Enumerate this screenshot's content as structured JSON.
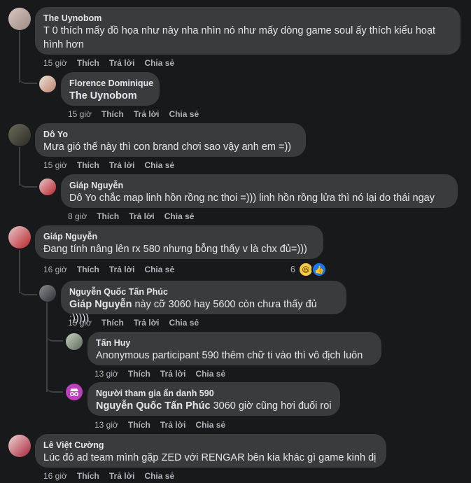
{
  "actions": {
    "like": "Thích",
    "reply": "Trả lời",
    "share": "Chia sẻ"
  },
  "comments": [
    {
      "author": "The Uynobom",
      "text": "T 0 thích mấy đồ họa như này nha nhìn nó như mấy dòng game soul ấy thích kiểu hoạt hình hơn",
      "time": "15 giờ"
    },
    {
      "author": "Florence Dominique",
      "mention": "The Uynobom",
      "text": "",
      "time": "15 giờ"
    },
    {
      "author": "Dô Yo",
      "text": "Mưa gió thế này thì con brand chơi sao vậy anh em =))",
      "time": "15 giờ"
    },
    {
      "author": "Giáp Nguyễn",
      "mention": "Dô Yo",
      "text": " chắc map linh hồn rồng nc thoi =))) linh hồn rồng lửa thì nó lại do thái ngay",
      "time": "8 giờ"
    },
    {
      "author": "Giáp Nguyễn",
      "text": "Đang tính nâng lên rx 580 nhưng bỗng thấy v là chx đủ=)))",
      "time": "16 giờ",
      "reactions": "6"
    },
    {
      "author": "Nguyễn Quốc Tấn Phúc",
      "mention": "Giáp Nguyễn",
      "text": " này cỡ 3060 hay 5600 còn chưa thấy đủ :)))))",
      "time": "15 giờ"
    },
    {
      "author": "Tấn Huy",
      "text": "Anonymous participant 590 thêm chữ ti vào thì vô địch luôn",
      "time": "13 giờ"
    },
    {
      "author": "Người tham gia ẩn danh 590",
      "mention": "Nguyễn Quốc Tấn Phúc",
      "text": " 3060 giờ cũng hơi đuối roi",
      "time": "13 giờ"
    },
    {
      "author": "Lê Việt Cường",
      "text": "Lúc đó ad team mình gặp ZED với RENGAR bên kia khác gì game kinh dị",
      "time": "16 giờ"
    }
  ],
  "colors": {
    "background": "#18191a",
    "bubble": "#3a3b3c",
    "text": "#e4e6eb",
    "muted": "#b0b3b8",
    "anon": "#bc3fbc"
  }
}
